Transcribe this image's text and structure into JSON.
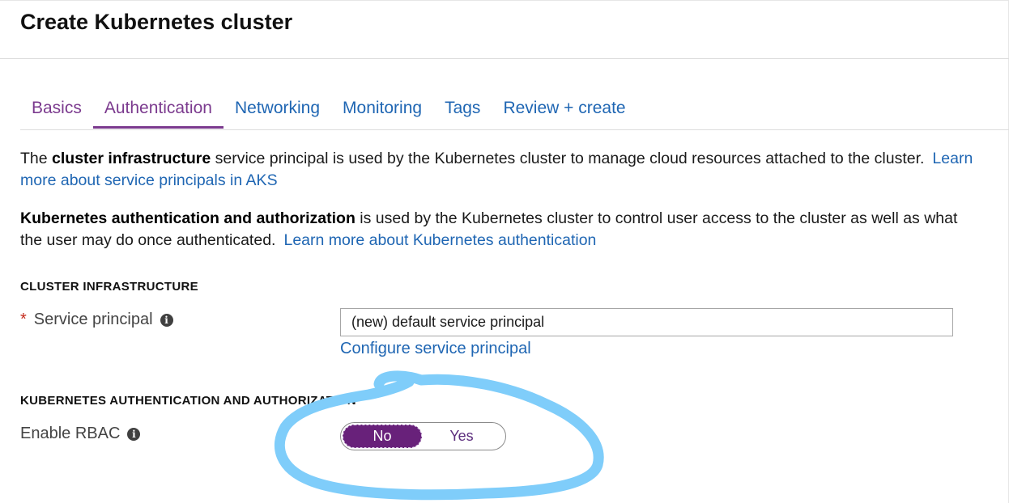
{
  "page": {
    "title": "Create Kubernetes cluster"
  },
  "tabs": [
    {
      "label": "Basics",
      "active": false
    },
    {
      "label": "Authentication",
      "active": true
    },
    {
      "label": "Networking",
      "active": false
    },
    {
      "label": "Monitoring",
      "active": false
    },
    {
      "label": "Tags",
      "active": false
    },
    {
      "label": "Review + create",
      "active": false
    }
  ],
  "intro": {
    "p1_bold": "cluster infrastructure",
    "p1_before": "The ",
    "p1_after": " service principal is used by the Kubernetes cluster to manage cloud resources attached to the cluster.",
    "p1_link": "Learn more about service principals in AKS",
    "p2_bold": "Kubernetes authentication and authorization",
    "p2_after": " is used by the Kubernetes cluster to control user access to the cluster as well as what the user may do once authenticated.",
    "p2_link": "Learn more about Kubernetes authentication"
  },
  "cluster_infrastructure": {
    "heading": "CLUSTER INFRASTRUCTURE",
    "required_marker": "*",
    "service_principal_label": "Service principal",
    "service_principal_value": "(new) default service principal",
    "configure_link": "Configure service principal"
  },
  "k8s_auth": {
    "heading": "KUBERNETES AUTHENTICATION AND AUTHORIZATION",
    "rbac_label": "Enable RBAC",
    "toggle_no": "No",
    "toggle_yes": "Yes",
    "selected": "No"
  },
  "icons": {
    "info": "info-icon"
  },
  "colors": {
    "accent_purple": "#7b3a8e",
    "toggle_selected": "#68217a",
    "link_blue": "#1f66b3",
    "required_red": "#c42b1c",
    "annotation_stroke": "#7fcdfa"
  }
}
